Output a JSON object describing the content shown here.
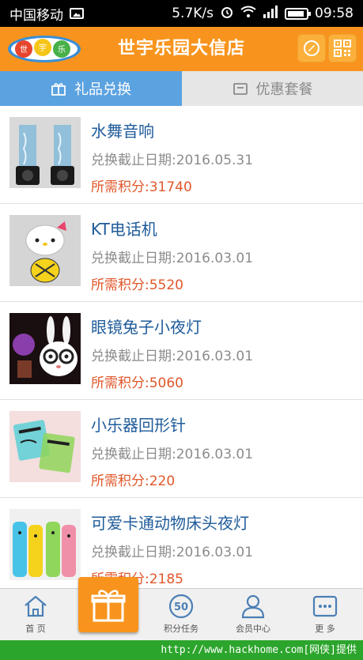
{
  "status_bar": {
    "carrier": "中国移动",
    "speed": "5.7K/s",
    "time": "09:58"
  },
  "header": {
    "logo_text": "世宇乐园",
    "title": "世宇乐园大信店",
    "compass_icon": "compass-icon",
    "qr_icon": "qr-code-icon"
  },
  "tabs": [
    {
      "label": "礼品兑换",
      "icon": "gift-outline-icon",
      "active": true
    },
    {
      "label": "优惠套餐",
      "icon": "package-icon",
      "active": false
    }
  ],
  "items": [
    {
      "name": "水舞音响",
      "deadline": "兑换截止日期:2016.05.31",
      "points": "所需积分:31740"
    },
    {
      "name": "KT电话机",
      "deadline": "兑换截止日期:2016.03.01",
      "points": "所需积分:5520"
    },
    {
      "name": "眼镜兔子小夜灯",
      "deadline": "兑换截止日期:2016.03.01",
      "points": "所需积分:5060"
    },
    {
      "name": "小乐器回形针",
      "deadline": "兑换截止日期:2016.03.01",
      "points": "所需积分:220"
    },
    {
      "name": "可爱卡通动物床头夜灯",
      "deadline": "兑换截止日期:2016.03.01",
      "points": "所需积分:2185"
    }
  ],
  "bottom_nav": {
    "home": "首 页",
    "tasks": "积分任务",
    "tasks_badge": "50",
    "member": "会员中心",
    "more": "更 多"
  },
  "watermark": "http://www.hackhome.com[网侠]提供",
  "colors": {
    "header": "#f8941d",
    "active_tab": "#5ba2e0",
    "item_name": "#1f5b9a",
    "points": "#e0572a"
  }
}
